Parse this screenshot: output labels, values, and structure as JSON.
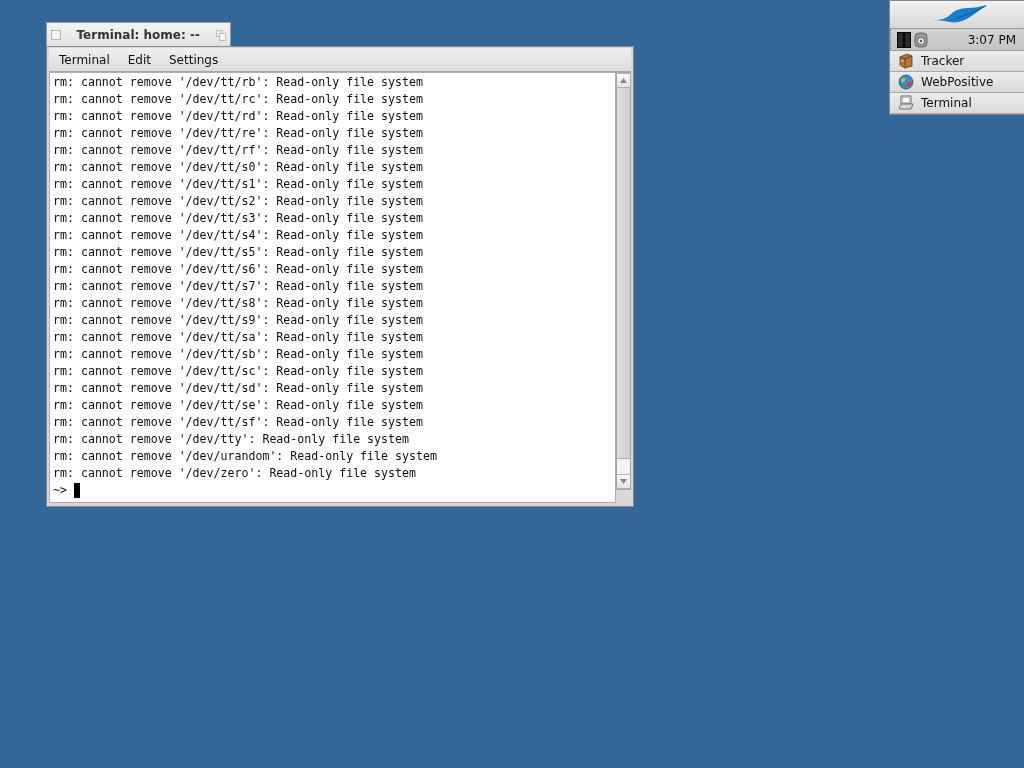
{
  "window": {
    "title": "Terminal: home: --",
    "menu": [
      "Terminal",
      "Edit",
      "Settings"
    ]
  },
  "terminal": {
    "lines": [
      "rm: cannot remove '/dev/tt/rb': Read-only file system",
      "rm: cannot remove '/dev/tt/rc': Read-only file system",
      "rm: cannot remove '/dev/tt/rd': Read-only file system",
      "rm: cannot remove '/dev/tt/re': Read-only file system",
      "rm: cannot remove '/dev/tt/rf': Read-only file system",
      "rm: cannot remove '/dev/tt/s0': Read-only file system",
      "rm: cannot remove '/dev/tt/s1': Read-only file system",
      "rm: cannot remove '/dev/tt/s2': Read-only file system",
      "rm: cannot remove '/dev/tt/s3': Read-only file system",
      "rm: cannot remove '/dev/tt/s4': Read-only file system",
      "rm: cannot remove '/dev/tt/s5': Read-only file system",
      "rm: cannot remove '/dev/tt/s6': Read-only file system",
      "rm: cannot remove '/dev/tt/s7': Read-only file system",
      "rm: cannot remove '/dev/tt/s8': Read-only file system",
      "rm: cannot remove '/dev/tt/s9': Read-only file system",
      "rm: cannot remove '/dev/tt/sa': Read-only file system",
      "rm: cannot remove '/dev/tt/sb': Read-only file system",
      "rm: cannot remove '/dev/tt/sc': Read-only file system",
      "rm: cannot remove '/dev/tt/sd': Read-only file system",
      "rm: cannot remove '/dev/tt/se': Read-only file system",
      "rm: cannot remove '/dev/tt/sf': Read-only file system",
      "rm: cannot remove '/dev/tty': Read-only file system",
      "rm: cannot remove '/dev/urandom': Read-only file system",
      "rm: cannot remove '/dev/zero': Read-only file system"
    ],
    "prompt": "~>"
  },
  "deskbar": {
    "clock": "3:07 PM",
    "apps": [
      {
        "kind": "tracker",
        "label": "Tracker"
      },
      {
        "kind": "browser",
        "label": "WebPositive"
      },
      {
        "kind": "terminal",
        "label": "Terminal"
      }
    ]
  }
}
